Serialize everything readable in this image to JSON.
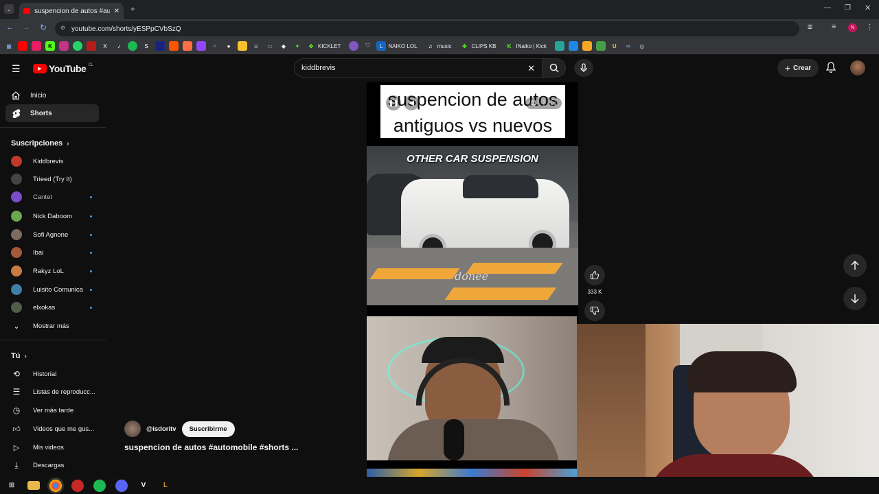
{
  "browser": {
    "tab_title": "suspencion de autos #automobile",
    "url": "youtube.com/shorts/yESPpCVbSzQ",
    "bookmarks": [
      "KICKLET",
      "NAIKO LOL",
      "music",
      "CLIPS KB",
      "INaiko | Kick"
    ]
  },
  "youtube": {
    "logo_text": "YouTube",
    "country_code": "CL",
    "search_value": "kiddbrevis",
    "create_label": "Crear"
  },
  "sidebar": {
    "main": [
      {
        "label": "Inicio",
        "icon": "home-icon"
      },
      {
        "label": "Shorts",
        "icon": "shorts-icon"
      }
    ],
    "subscriptions_title": "Suscripciones",
    "subscriptions": [
      {
        "label": "Kiddbrevis",
        "color": "#c0392b"
      },
      {
        "label": "Trieed (Try It)",
        "color": "#444"
      },
      {
        "label": "Cantet",
        "color": "#7a4cc9"
      },
      {
        "label": "Nick Daboom",
        "color": "#6aa84f"
      },
      {
        "label": "Sofi Agnone",
        "color": "#7d6a60"
      },
      {
        "label": "Ibai",
        "color": "#a35a3a"
      },
      {
        "label": "Rakyz LoL",
        "color": "#c87c44"
      },
      {
        "label": "Luisito Comunica",
        "color": "#3d7fa6"
      },
      {
        "label": "elxokas",
        "color": "#4f5d4a"
      }
    ],
    "show_more": "Mostrar más",
    "you_title": "Tú",
    "you_items": [
      {
        "label": "Historial",
        "icon": "history-icon"
      },
      {
        "label": "Listas de reproducc...",
        "icon": "playlists-icon"
      },
      {
        "label": "Ver más tarde",
        "icon": "watch-later-icon"
      },
      {
        "label": "Videos que me gus...",
        "icon": "liked-videos-icon"
      },
      {
        "label": "Mis videos",
        "icon": "my-videos-icon"
      },
      {
        "label": "Descargas",
        "icon": "downloads-icon"
      }
    ]
  },
  "short": {
    "title_card": "suspencion de autos antiguos vs nuevos",
    "overlay_text": "OTHER CAR SUSPENSION",
    "watermark": "donee",
    "likes": "333 K",
    "channel": "@isdoritv",
    "subscribe_label": "Suscribirme",
    "video_title": "suspencion de autos #automobile #shorts ..."
  }
}
